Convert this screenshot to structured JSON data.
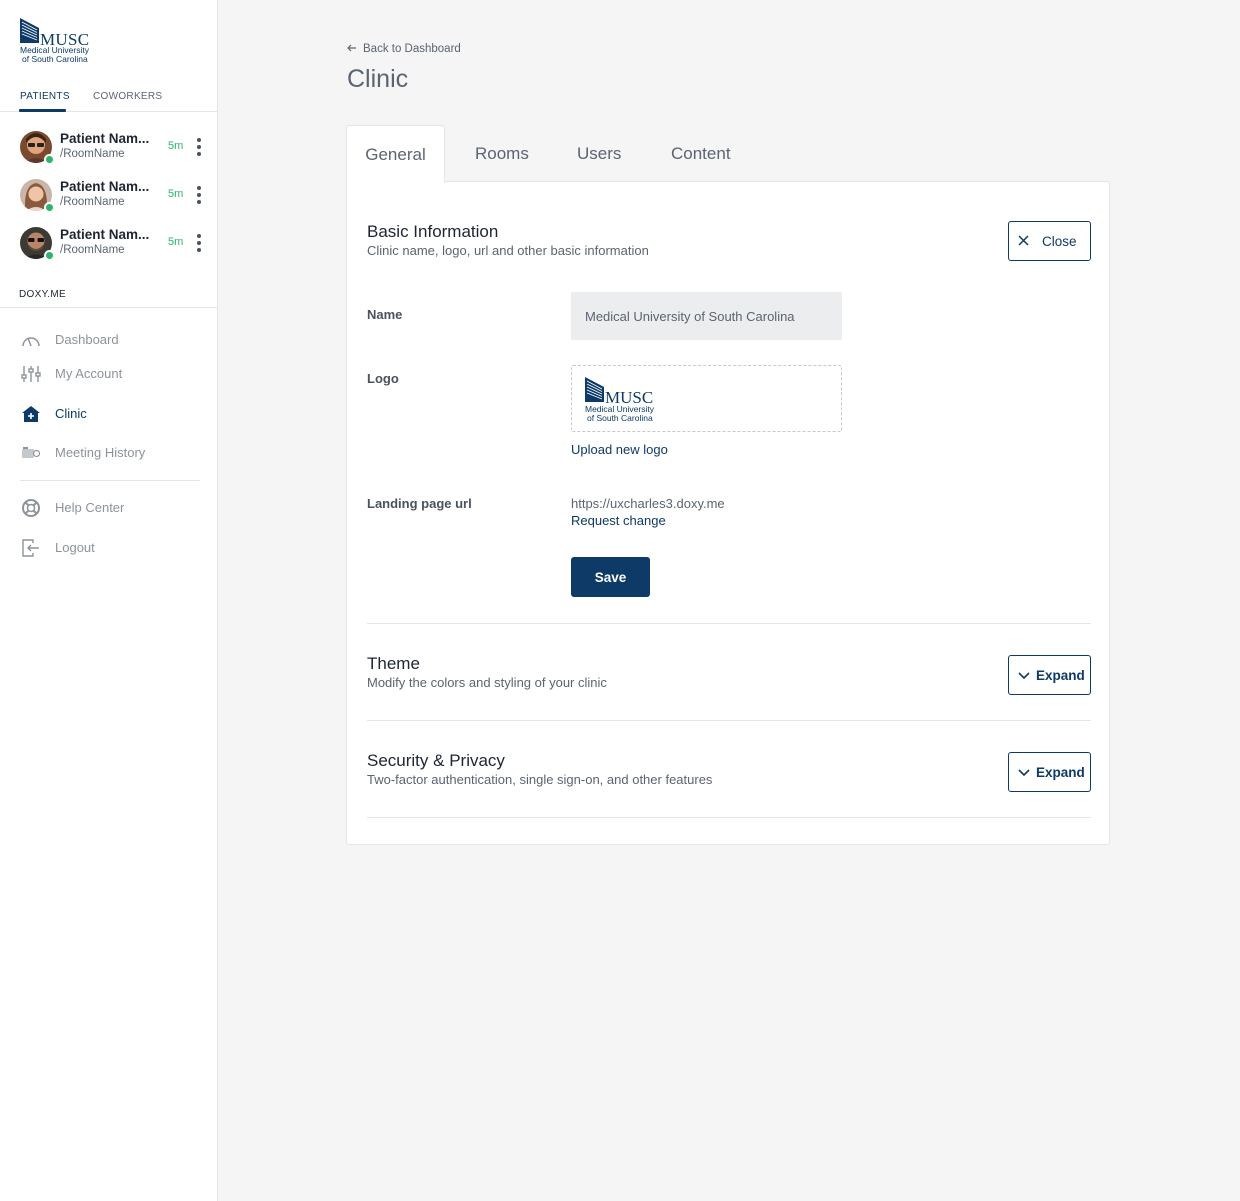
{
  "brand": {
    "logo_text": "MUSC",
    "logo_line1": "Medical University",
    "logo_line2": "of South Carolina",
    "primary_color": "#0d3a66",
    "online_color": "#2db36a"
  },
  "sidebar": {
    "tabs": [
      {
        "label": "PATIENTS",
        "active": true
      },
      {
        "label": "COWORKERS",
        "active": false
      }
    ],
    "patients": [
      {
        "name": "Patient Nam...",
        "room": "/RoomName",
        "time": "5m",
        "status": "online"
      },
      {
        "name": "Patient Nam...",
        "room": "/RoomName",
        "time": "5m",
        "status": "online"
      },
      {
        "name": "Patient Nam...",
        "room": "/RoomName",
        "time": "5m",
        "status": "online"
      }
    ],
    "section_label": "DOXY.ME",
    "nav": [
      {
        "label": "Dashboard",
        "icon": "gauge-icon"
      },
      {
        "label": "My Account",
        "icon": "sliders-icon"
      },
      {
        "label": "Clinic",
        "icon": "clinic-house-icon",
        "active": true
      },
      {
        "label": "Meeting History",
        "icon": "video-camera-icon"
      },
      {
        "label": "Help Center",
        "icon": "lifebuoy-icon"
      },
      {
        "label": "Logout",
        "icon": "logout-icon"
      }
    ]
  },
  "main": {
    "back_link": "Back to Dashboard",
    "title": "Clinic",
    "tabs": [
      {
        "label": "General",
        "active": true
      },
      {
        "label": "Rooms"
      },
      {
        "label": "Users"
      },
      {
        "label": "Content"
      }
    ],
    "basic": {
      "title": "Basic Information",
      "description": "Clinic name, logo, url and other basic information",
      "close_label": "Close",
      "name_label": "Name",
      "name_value": "Medical University of South Carolina",
      "logo_label": "Logo",
      "upload_link": "Upload new logo",
      "url_label": "Landing page url",
      "url_value": "https://uxcharles3.doxy.me",
      "request_link": "Request change",
      "save_label": "Save"
    },
    "theme": {
      "title": "Theme",
      "description": "Modify the colors and styling of your clinic",
      "expand_label": "Expand"
    },
    "security": {
      "title": "Security & Privacy",
      "description": "Two-factor authentication, single sign-on, and other features",
      "expand_label": "Expand"
    }
  }
}
